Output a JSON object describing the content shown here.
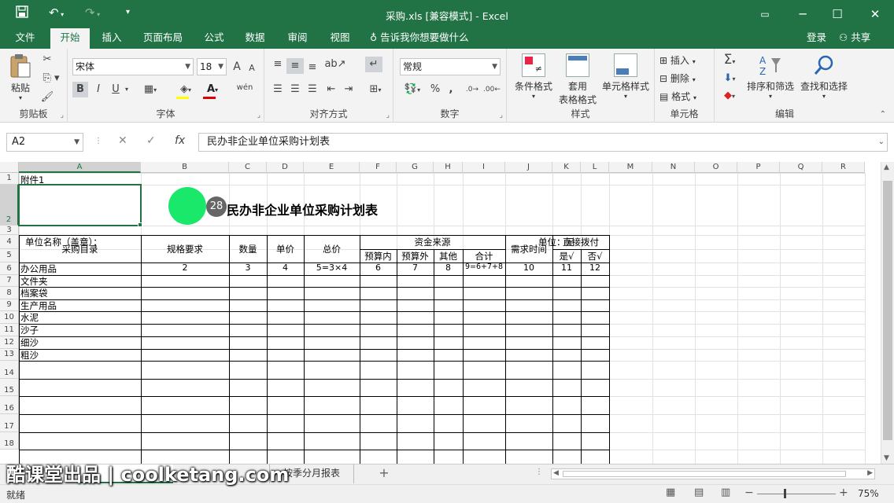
{
  "window": {
    "title": "采购.xls  [兼容模式] - Excel"
  },
  "menu": {
    "tabs": [
      "文件",
      "开始",
      "插入",
      "页面布局",
      "公式",
      "数据",
      "审阅",
      "视图"
    ],
    "tell_me": "告诉我你想要做什么",
    "login": "登录",
    "share": "共享"
  },
  "ribbon": {
    "clipboard": {
      "label": "剪贴板",
      "paste": "粘贴"
    },
    "font": {
      "label": "字体",
      "name": "宋体",
      "size": "18",
      "bold": "B",
      "italic": "I",
      "underline": "U",
      "grow": "A",
      "shrink": "A",
      "phonetic": "wén"
    },
    "alignment": {
      "label": "对齐方式"
    },
    "number": {
      "label": "数字",
      "format": "常规",
      "percent": "%",
      "comma": ","
    },
    "styles": {
      "label": "样式",
      "conditional": "条件格式",
      "table_line1": "套用",
      "table_line2": "表格格式",
      "cell_styles": "单元格样式"
    },
    "cells": {
      "label": "单元格",
      "insert": "插入",
      "delete": "删除",
      "format": "格式"
    },
    "editing": {
      "label": "编辑",
      "sort": "排序和筛选",
      "find": "查找和选择"
    }
  },
  "formula_bar": {
    "name_box": "A2",
    "fx": "fx",
    "content": "民办非企业单位采购计划表"
  },
  "sheet": {
    "columns": [
      "A",
      "B",
      "C",
      "D",
      "E",
      "F",
      "G",
      "H",
      "I",
      "J",
      "K",
      "L",
      "M",
      "N",
      "O",
      "P",
      "Q",
      "R"
    ],
    "rows": [
      "1",
      "2",
      "3",
      "4",
      "5",
      "6",
      "7",
      "8",
      "9",
      "10",
      "11",
      "12",
      "13",
      "14",
      "15",
      "16",
      "17",
      "18"
    ],
    "a1": "附件1",
    "title": "民办非企业单位采购计划表",
    "unit_name": "单位名称（盖章）：",
    "unit": "单位：元",
    "headers": {
      "catalog": "采购目录",
      "spec": "规格要求",
      "qty": "数量",
      "price": "单价",
      "total": "总价",
      "funds": "资金来源",
      "in_budget": "预算内",
      "out_budget": "预算外",
      "other": "其他",
      "sum": "合计",
      "need_time": "需求时间",
      "direct": "直接拨付",
      "yes": "是√",
      "no": "否√"
    },
    "row6": [
      "办公用品",
      "2",
      "3",
      "4",
      "5=3×4",
      "6",
      "7",
      "8",
      "9=6+7+8",
      "10",
      "11",
      "12"
    ],
    "items": [
      "文件夹",
      "档案袋",
      "生产用品",
      "水泥",
      "沙子",
      "细沙",
      "粗沙"
    ]
  },
  "cursor_badge": "28",
  "sheet_tabs": {
    "tab2": "按季分月报表",
    "add": "+"
  },
  "status": {
    "ready": "就绪",
    "zoom": "75%"
  },
  "watermark": "酷课堂出品 | coolketang.com",
  "colors": {
    "accent": "#217346",
    "cursor": "#19e86a"
  }
}
